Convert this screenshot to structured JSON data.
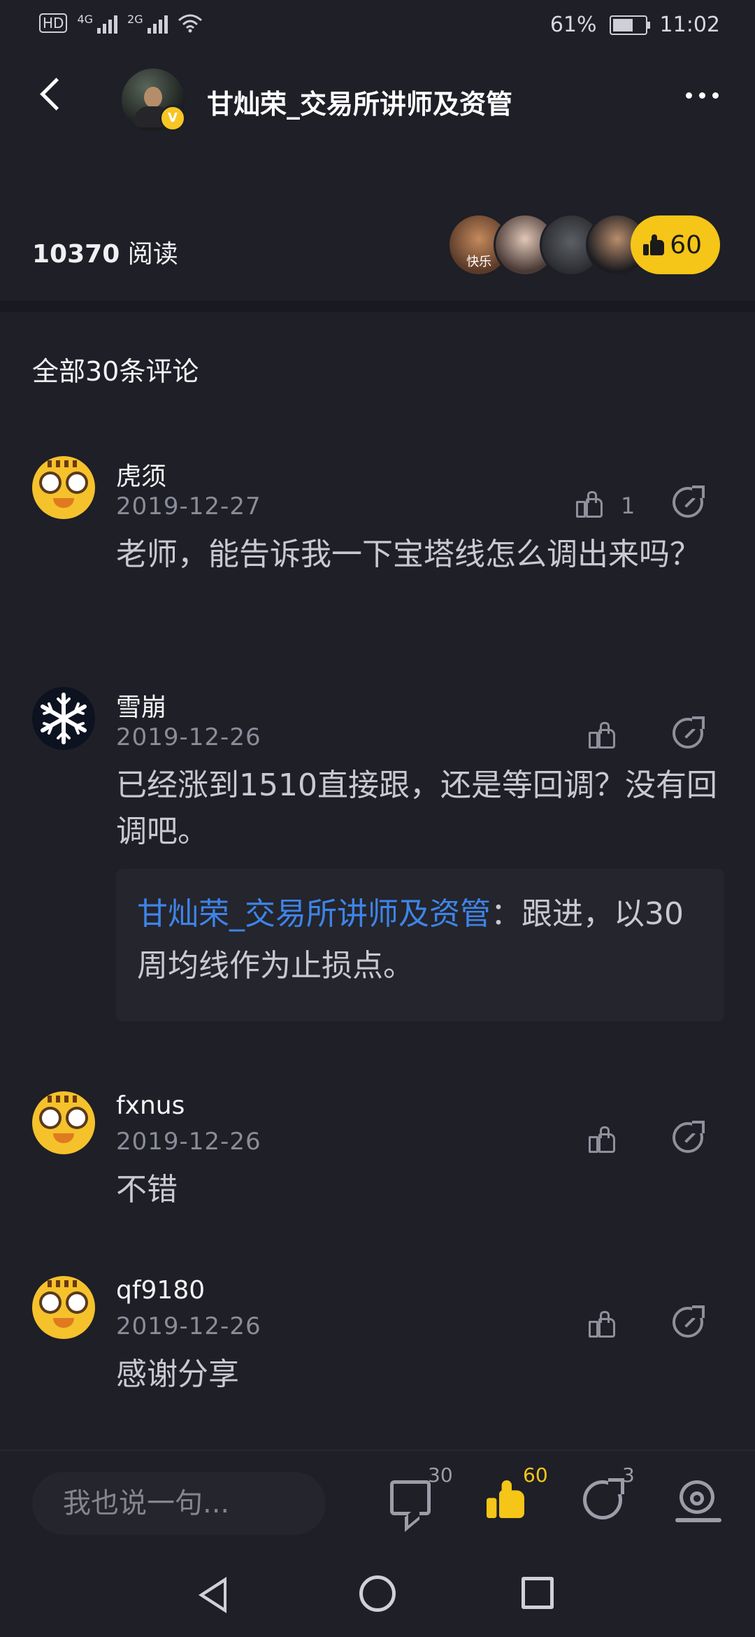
{
  "status_bar": {
    "hd": "HD",
    "sim1": "4G",
    "sim2": "2G",
    "battery": "61%",
    "time": "11:02"
  },
  "header": {
    "author": "甘灿荣_交易所讲师及资管",
    "verified_mark": "V"
  },
  "stats": {
    "reads_count": "10370",
    "reads_label": "阅读",
    "liker_caption": "快乐",
    "like_count": "60"
  },
  "comments_section": {
    "title": "全部30条评论"
  },
  "comments": [
    {
      "name": "虎须",
      "date": "2019-12-27",
      "likes": "1",
      "text": "老师，能告诉我一下宝塔线怎么调出来吗？"
    },
    {
      "name": "雪崩",
      "date": "2019-12-26",
      "likes": "",
      "text": "已经涨到1510直接跟，还是等回调？没有回调吧。",
      "reply": {
        "author": "甘灿荣_交易所讲师及资管",
        "separator": "：",
        "text": "跟进，以30周均线作为止损点。"
      }
    },
    {
      "name": "fxnus",
      "date": "2019-12-26",
      "likes": "",
      "text": "不错"
    },
    {
      "name": "qf9180",
      "date": "2019-12-26",
      "likes": "",
      "text": "感谢分享"
    }
  ],
  "bottom_bar": {
    "input_placeholder": "我也说一句...",
    "comment_count": "30",
    "like_count": "60",
    "share_count": "3"
  },
  "colors": {
    "background": "#1e1f27",
    "accent_yellow": "#f5c518",
    "link_blue": "#3e84e8",
    "muted_text": "#8a8c99"
  },
  "icons": [
    "back-arrow-icon",
    "more-icon",
    "thumbs-up-icon",
    "share-icon",
    "comment-icon",
    "favorite-icon"
  ]
}
